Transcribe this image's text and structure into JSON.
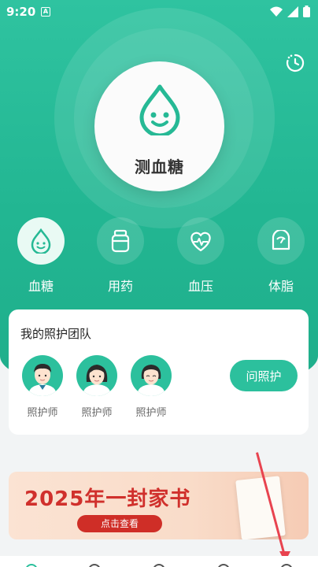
{
  "status_bar": {
    "time": "9:20",
    "notif_letter": "A"
  },
  "main": {
    "measure_label": "测血糖",
    "categories": [
      {
        "label": "血糖",
        "icon": "drop-face-icon",
        "active": true
      },
      {
        "label": "用药",
        "icon": "medicine-bottle-icon",
        "active": false
      },
      {
        "label": "血压",
        "icon": "heart-pulse-icon",
        "active": false
      },
      {
        "label": "体脂",
        "icon": "scale-icon",
        "active": false
      }
    ]
  },
  "team": {
    "title": "我的照护团队",
    "members": [
      {
        "name": "照护师",
        "icon": "male-caregiver-avatar"
      },
      {
        "name": "照护师",
        "icon": "female-caregiver-avatar"
      },
      {
        "name": "照护师",
        "icon": "female-caregiver-avatar"
      }
    ],
    "ask_button": "问照护"
  },
  "banner": {
    "title": "2025年一封家书",
    "button": "点击查看"
  },
  "colors": {
    "primary": "#2cc09d",
    "banner_red": "#cf2e27",
    "annotation_arrow": "#e8434f"
  }
}
